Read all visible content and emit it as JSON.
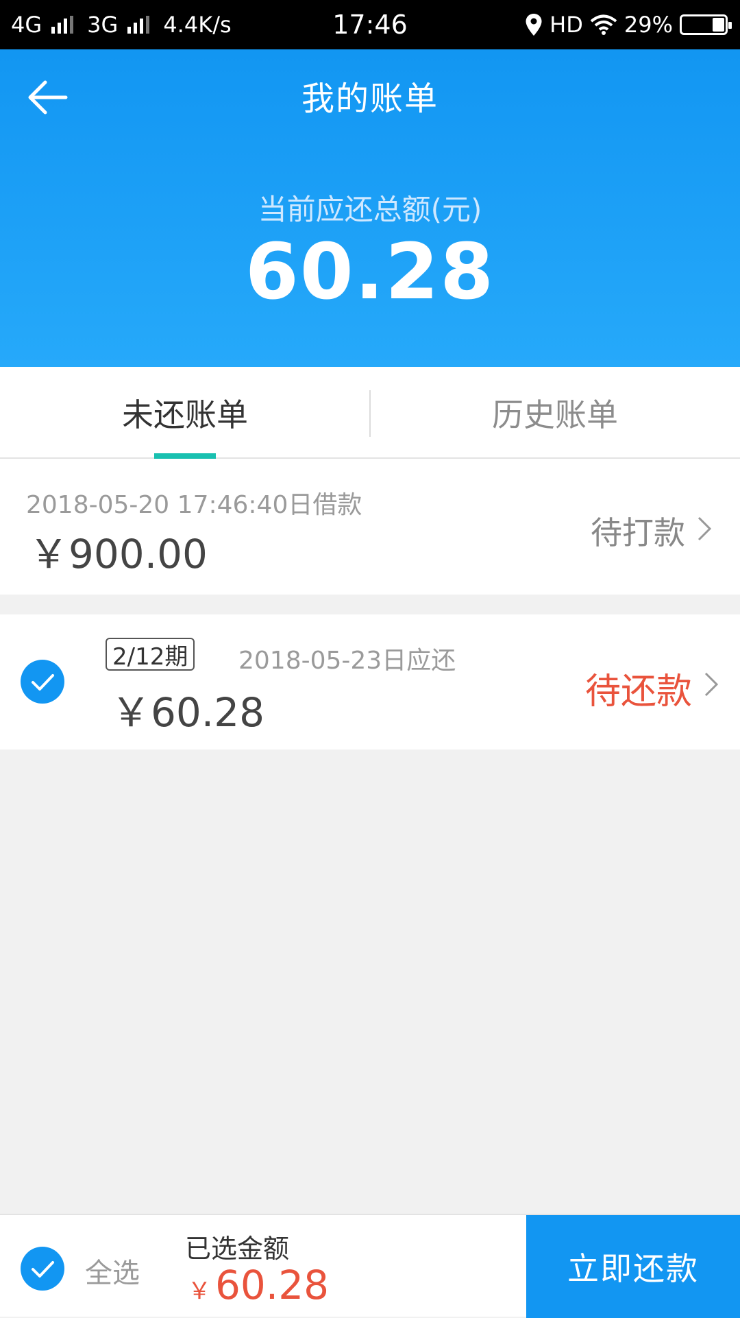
{
  "status_bar": {
    "net1": "4G",
    "net2": "3G",
    "speed": "4.4K/s",
    "time": "17:46",
    "hd": "HD",
    "battery": "29%",
    "battery_level": 0.29,
    "icons": [
      "signal-bars-icon",
      "location-pin-icon",
      "wifi-icon",
      "battery-icon"
    ]
  },
  "header": {
    "title": "我的账单",
    "back_icon": "back-arrow-icon",
    "total_label": "当前应还总额(元)",
    "total_amount": "60.28"
  },
  "tabs": [
    {
      "label": "未还账单",
      "active": true
    },
    {
      "label": "历史账单",
      "active": false
    }
  ],
  "loan": {
    "date": "2018-05-20 17:46:40日借款",
    "amount": "￥900.00",
    "status": "待打款",
    "chevron_icon": "chevron-right-icon"
  },
  "installment": {
    "checked": true,
    "period": "2/12期",
    "due_date": "2018-05-23日应还",
    "amount": "￥60.28",
    "status": "待还款",
    "chevron_icon": "chevron-right-icon"
  },
  "bottom_bar": {
    "select_all": "全选",
    "selected_label": "已选金额",
    "currency": "￥",
    "selected_amount": "60.28",
    "pay_button": "立即还款"
  },
  "colors": {
    "primary": "#1296f2",
    "accent_red": "#e9533c",
    "tab_indicator": "#19c0b0",
    "background": "#f1f1f1"
  }
}
